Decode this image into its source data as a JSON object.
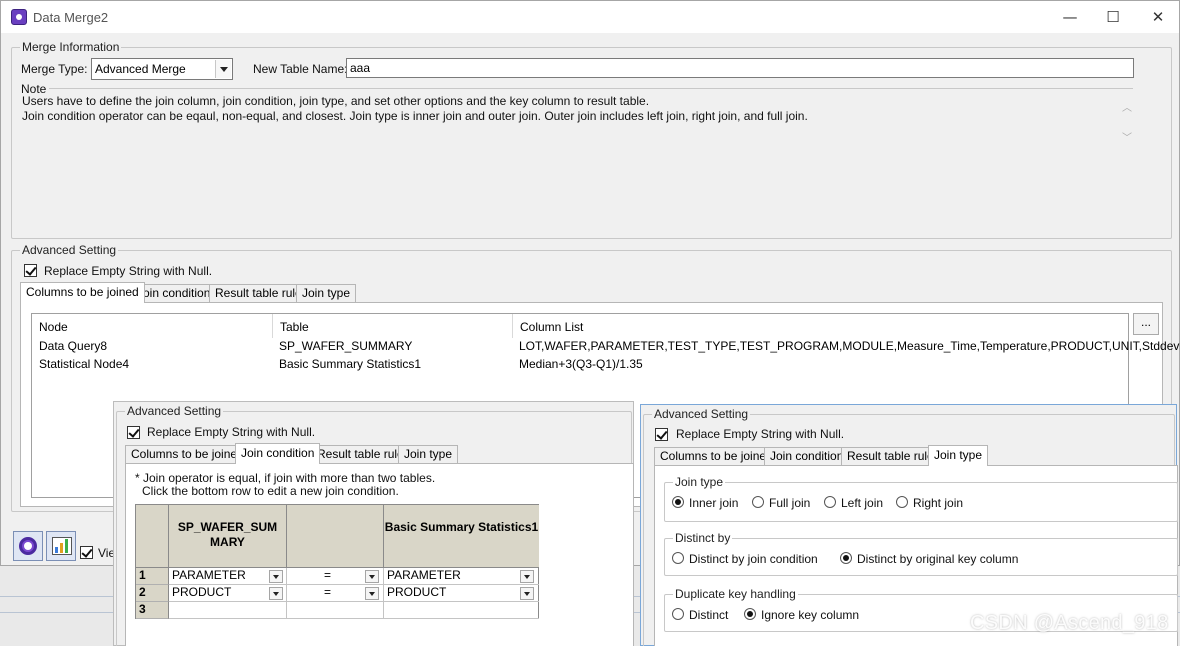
{
  "window": {
    "title": "Data Merge2",
    "controls": {
      "minimize": "—",
      "maximize": "☐",
      "close": "✕"
    }
  },
  "merge_info": {
    "legend": "Merge Information",
    "merge_type_label": "Merge Type:",
    "merge_type_value": "Advanced Merge",
    "new_table_label": "New Table Name:",
    "new_table_value": "aaa",
    "note_label": "Note",
    "note_lines": [
      "Users have to define the join column, join condition, join type, and set other options and the key column to result table.",
      "Join condition operator can be eqaul, non-equal, and closest. Join type is inner join and outer join. Outer join includes left join, right join, and full join."
    ]
  },
  "advanced": {
    "legend": "Advanced Setting",
    "replace_null_label": "Replace Empty String  with Null.",
    "replace_null_checked": true,
    "tabs": [
      "Columns to be joined",
      "Join condition",
      "Result table rule",
      "Join type"
    ],
    "active_tab": "Columns to be joined",
    "columns_headers": [
      "Node",
      "Table",
      "Column List"
    ],
    "rows": [
      {
        "node": "Data Query8",
        "table": "SP_WAFER_SUMMARY",
        "columns": "LOT,WAFER,PARAMETER,TEST_TYPE,TEST_PROGRAM,MODULE,Measure_Time,Temperature,PRODUCT,UNIT,Stddev"
      },
      {
        "node": "Statistical Node4",
        "table": "Basic Summary Statistics1",
        "columns": "Median+3(Q3-Q1)/1.35"
      }
    ],
    "ellipsis_label": "..."
  },
  "bottom": {
    "view_label": "Vie"
  },
  "join_condition_pane": {
    "legend": "Advanced Setting",
    "replace_null_label": "Replace Empty String  with Null.",
    "tabs": [
      "Columns to be joined",
      "Join condition",
      "Result table rule",
      "Join type"
    ],
    "active_tab": "Join condition",
    "hint_lines": [
      "* Join operator is equal, if join with more than two tables.",
      "Click the bottom row to edit a new join condition."
    ],
    "col_left": "SP_WAFER_SUM MARY",
    "col_right": "Basic Summary Statistics1",
    "rows": [
      {
        "n": "1",
        "left": "PARAMETER",
        "op": "=",
        "right": "PARAMETER"
      },
      {
        "n": "2",
        "left": "PRODUCT",
        "op": "=",
        "right": "PRODUCT"
      },
      {
        "n": "3",
        "left": "",
        "op": "",
        "right": ""
      }
    ]
  },
  "join_type_pane": {
    "legend": "Advanced Setting",
    "replace_null_label": "Replace Empty String  with Null.",
    "tabs": [
      "Columns to be joined",
      "Join condition",
      "Result table rule",
      "Join type"
    ],
    "active_tab": "Join type",
    "join_type_group": "Join type",
    "join_type_options": [
      "Inner join",
      "Full join",
      "Left join",
      "Right join"
    ],
    "join_type_selected": "Inner join",
    "distinct_group": "Distinct by",
    "distinct_options": [
      "Distinct by join condition",
      "Distinct by original key column"
    ],
    "distinct_selected": "Distinct by original key column",
    "dup_group": "Duplicate key handling",
    "dup_options": [
      "Distinct",
      "Ignore key column"
    ],
    "dup_selected": "Ignore key column"
  },
  "watermark": "CSDN @Ascend_918"
}
